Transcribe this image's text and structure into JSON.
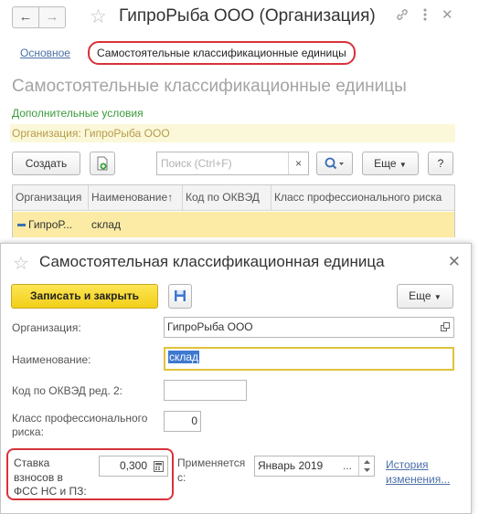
{
  "window": {
    "title": "ГипроРыба ООО (Организация)",
    "back_icon": "arrow-left-icon",
    "forward_icon": "arrow-right-icon",
    "favorite_icon": "star-icon",
    "link_icon": "link-icon",
    "menu_icon": "more-vertical-icon",
    "close_icon": "close-icon"
  },
  "tabs": {
    "main": "Основное",
    "active": "Самостоятельные классификационные единицы"
  },
  "list": {
    "title": "Самостоятельные классификационные единицы",
    "additional_conditions": "Дополнительные условия",
    "filter": "Организация: ГипроРыба ООО",
    "create_button": "Создать",
    "search_placeholder": "Поиск (Ctrl+F)",
    "clear_icon": "×",
    "search_icon": "magnifier-icon",
    "more_button": "Еще",
    "help_button": "?",
    "columns": [
      "Организация",
      "Наименование",
      "Код по ОКВЭД",
      "Класс профессионального риска"
    ],
    "sort_indicator": "↑",
    "rows": [
      {
        "organization": "ГипроР...",
        "name": "склад",
        "okved": "",
        "risk_class": ""
      }
    ]
  },
  "dialog": {
    "title": "Самостоятельная классификационная единица",
    "save_close_button": "Записать и закрыть",
    "save_icon": "floppy-disk-icon",
    "more_button": "Еще",
    "org_label": "Организация:",
    "org_value": "ГипроРыба ООО",
    "name_label": "Наименование:",
    "name_value": "склад",
    "okved_label": "Код по ОКВЭД ред. 2:",
    "okved_value": "",
    "risk_label_1": "Класс профессионального",
    "risk_label_2": "риска:",
    "risk_value": "0",
    "rate_label_1": "Ставка",
    "rate_label_2": "взносов в",
    "rate_label_3": "ФСС НС и ПЗ:",
    "rate_value": "0,300",
    "applied_label_1": "Применяется",
    "applied_label_2": "с:",
    "applied_value": "Январь 2019",
    "applied_ellipsis": "...",
    "history_link_1": "История",
    "history_link_2": "изменения..."
  },
  "colors": {
    "accent_yellow": "#f2cf19",
    "highlight_red": "#d8323a",
    "row_selected": "#fbeba4",
    "link_blue": "#4a6fa8",
    "green_text": "#3a9a3a"
  }
}
